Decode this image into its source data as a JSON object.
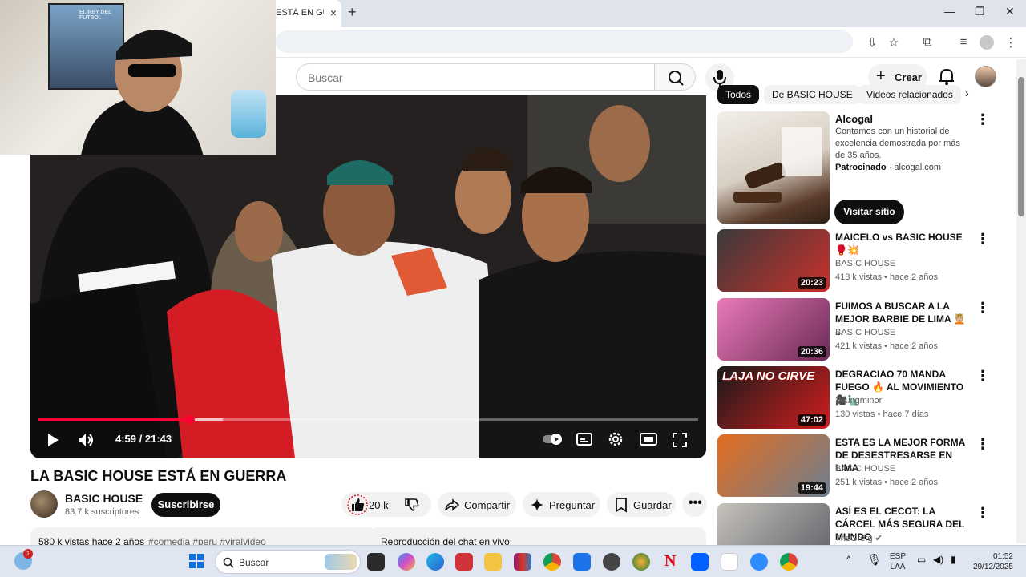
{
  "browser": {
    "tab_title": "ESTÁ EN GUERRA",
    "tab_close": "×",
    "new_tab": "+"
  },
  "header": {
    "search_placeholder": "Buscar",
    "create_label": "Crear"
  },
  "video": {
    "current_time": "4:59",
    "duration": "21:43",
    "time_display": "4:59 / 21:43",
    "progress_fraction": 0.23,
    "title": "LA BASIC HOUSE ESTÁ EN GUERRA",
    "channel": "BASIC HOUSE",
    "subscribers": "83.7 k suscriptores",
    "subscribe_label": "Suscribirse",
    "likes": "20 k",
    "share_label": "Compartir",
    "ask_label": "Preguntar",
    "save_label": "Guardar",
    "views_date": "580 k vistas  hace 2 años",
    "hashtags": "#comedia #peru #viralvideo",
    "chat_replay": "Reproducción del chat en vivo"
  },
  "webcam": {
    "poster_text": "EL REY DEL FUTBOL"
  },
  "sidebar": {
    "chips": [
      "Todos",
      "De BASIC HOUSE",
      "Videos relacionados"
    ],
    "ad": {
      "title": "Alcogal",
      "description": "Contamos con un historial de excelencia demostrada por más de 35 años.",
      "sponsored": "Patrocinado",
      "domain": "· alcogal.com",
      "button": "Visitar sitio"
    },
    "videos": [
      {
        "title": "MAICELO vs BASIC HOUSE 🥊💥",
        "channel": "BASIC HOUSE",
        "meta": "418 k vistas • hace 2 años",
        "duration": "20:23",
        "colors": [
          "#3a3a3a",
          "#c9302c"
        ]
      },
      {
        "title": "FUIMOS A BUSCAR A LA MEJOR BARBIE DE LIMA 💆🏼 ...",
        "channel": "BASIC HOUSE",
        "meta": "421 k vistas • hace 2 años",
        "duration": "20:36",
        "colors": [
          "#e87ab8",
          "#6b2a55"
        ]
      },
      {
        "title": "DEGRACIAO 70 MANDA FUEGO 🔥 AL MOVIMIENTO 🎥🗽",
        "channel": "Youngminor",
        "meta": "130 vistas • hace 7 días",
        "duration": "47:02",
        "colors": [
          "#1a1a1a",
          "#d21e1e"
        ]
      },
      {
        "title": "ESTA ES LA MEJOR FORMA DE DESESTRESARSE EN LIMA",
        "channel": "BASIC HOUSE",
        "meta": "251 k vistas • hace 2 años",
        "duration": "19:44",
        "colors": [
          "#e56d1f",
          "#6d7f8f"
        ]
      },
      {
        "title": "ASÍ ES EL CECOT: LA CÁRCEL MÁS SEGURA DEL MUNDO",
        "channel": "TheGrefg ✔",
        "meta": "",
        "duration": "",
        "colors": [
          "#c7c3bd",
          "#5c5f66"
        ]
      }
    ],
    "thumb_text_3": "LAJA NO CIRVE"
  },
  "taskbar": {
    "search_label": "Buscar",
    "lang_top": "ESP",
    "lang_bottom": "LAA",
    "time": "01:52",
    "date": "29/12/2025",
    "weather_badge": "1"
  }
}
